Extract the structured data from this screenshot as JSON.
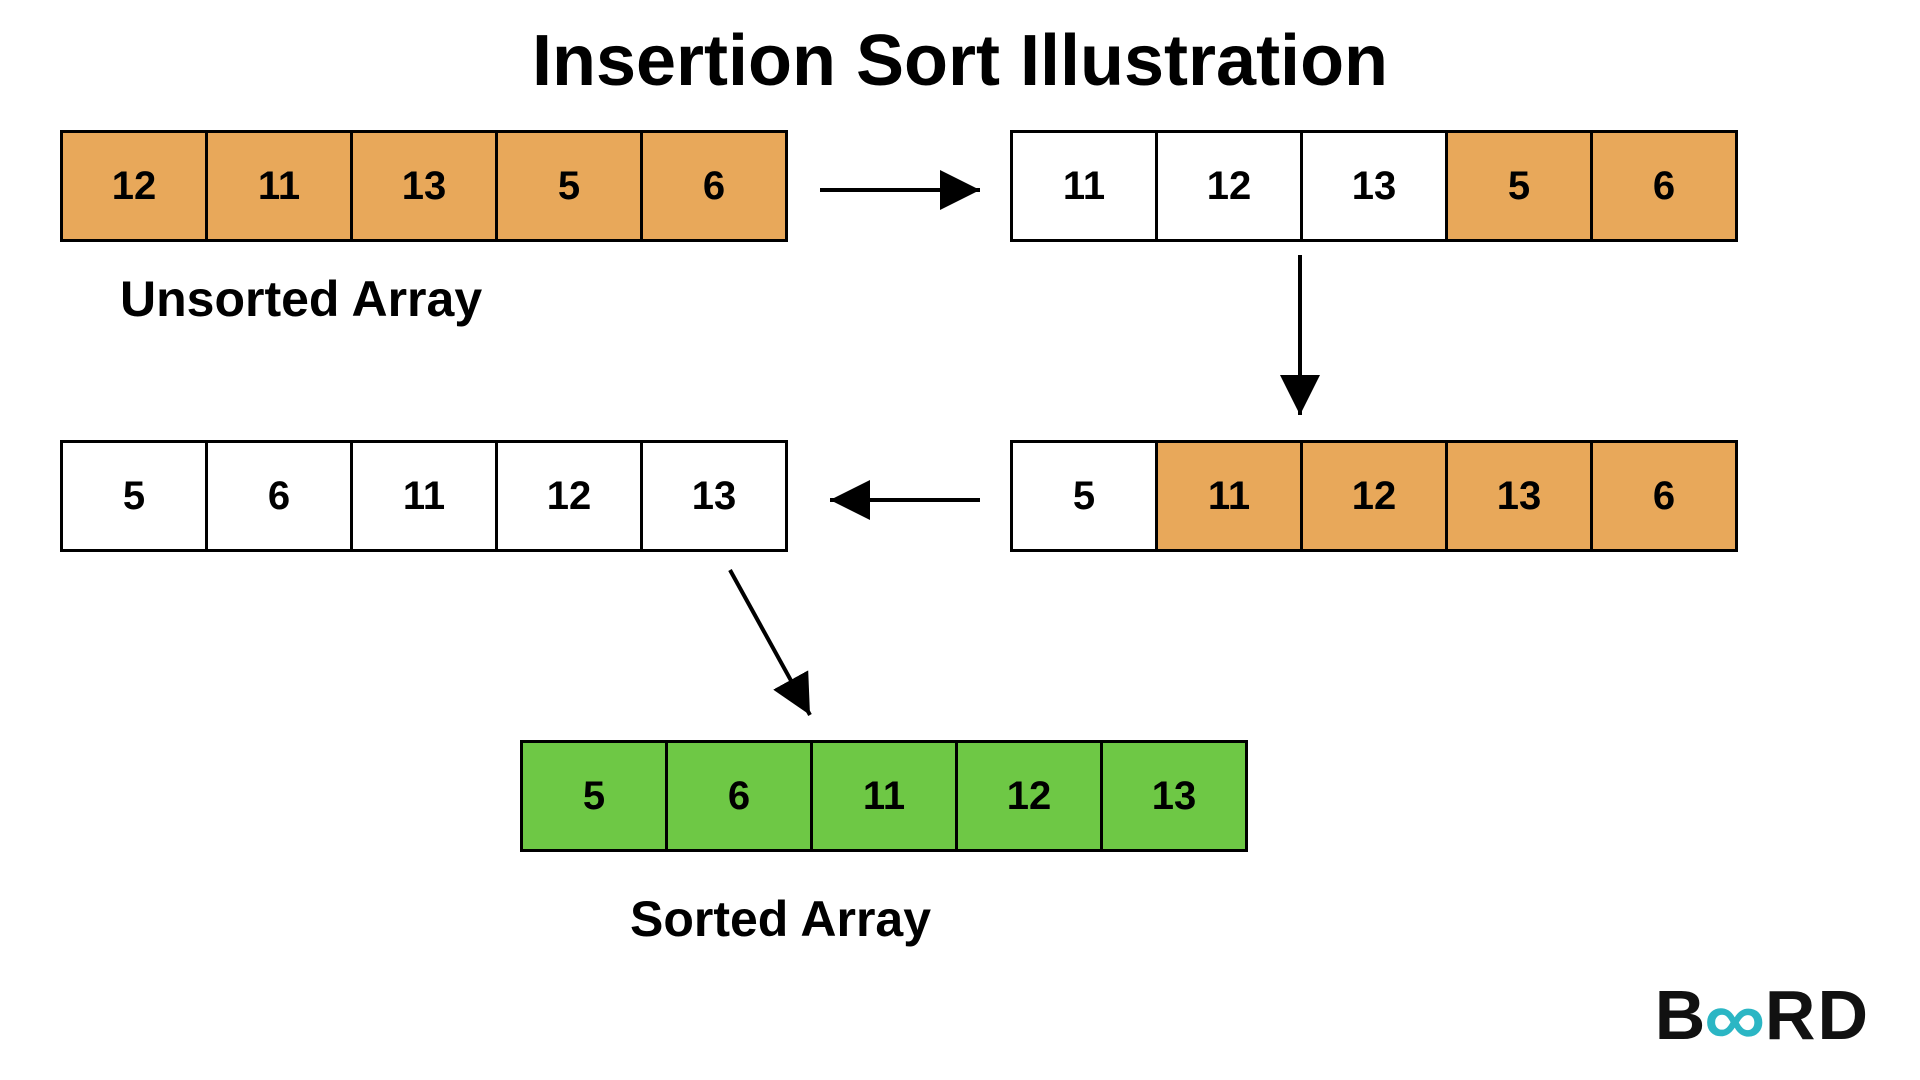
{
  "title": "Insertion Sort Illustration",
  "labels": {
    "unsorted": "Unsorted Array",
    "sorted": "Sorted Array"
  },
  "colors": {
    "orange": "#e8a85a",
    "white": "#ffffff",
    "green": "#6ec845",
    "stroke": "#000000"
  },
  "arrays": {
    "step1": {
      "values": [
        "12",
        "11",
        "13",
        "5",
        "6"
      ],
      "fills": [
        "orange",
        "orange",
        "orange",
        "orange",
        "orange"
      ]
    },
    "step2": {
      "values": [
        "11",
        "12",
        "13",
        "5",
        "6"
      ],
      "fills": [
        "white",
        "white",
        "white",
        "orange",
        "orange"
      ]
    },
    "step3": {
      "values": [
        "5",
        "11",
        "12",
        "13",
        "6"
      ],
      "fills": [
        "white",
        "orange",
        "orange",
        "orange",
        "orange"
      ]
    },
    "step4": {
      "values": [
        "5",
        "6",
        "11",
        "12",
        "13"
      ],
      "fills": [
        "white",
        "white",
        "white",
        "white",
        "white"
      ]
    },
    "final": {
      "values": [
        "5",
        "6",
        "11",
        "12",
        "13"
      ],
      "fills": [
        "green",
        "green",
        "green",
        "green",
        "green"
      ]
    }
  },
  "logo": {
    "b": "B",
    "rd": "RD",
    "infinity": "∞"
  }
}
